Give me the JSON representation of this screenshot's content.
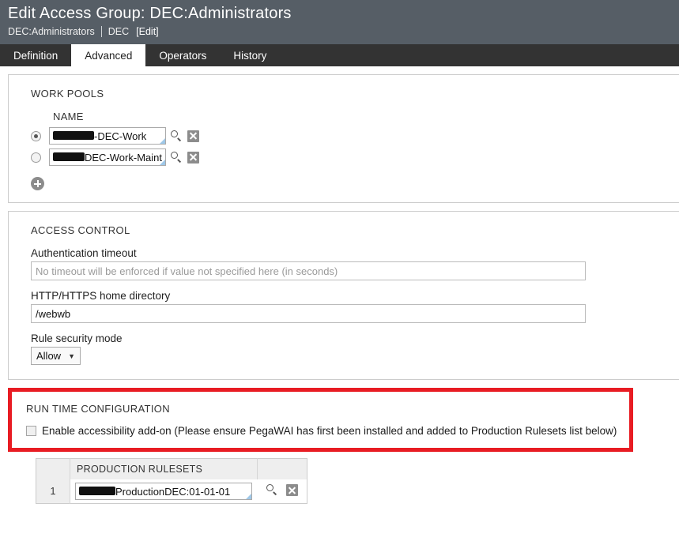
{
  "header": {
    "title": "Edit Access Group: DEC:Administrators",
    "breadcrumb": {
      "primary": "DEC:Administrators",
      "secondary": "DEC",
      "edit_link": "[Edit]"
    }
  },
  "tabs": [
    {
      "label": "Definition",
      "active": false
    },
    {
      "label": "Advanced",
      "active": true
    },
    {
      "label": "Operators",
      "active": false
    },
    {
      "label": "History",
      "active": false
    }
  ],
  "work_pools": {
    "section_title": "WORK POOLS",
    "column_header": "NAME",
    "rows": [
      {
        "selected": true,
        "value": "-DEC-Work",
        "redacted_prefix": true
      },
      {
        "selected": false,
        "value": "DEC-Work-Maint",
        "redacted_prefix": true
      }
    ],
    "add_icon": "plus-icon"
  },
  "access_control": {
    "section_title": "ACCESS CONTROL",
    "auth_timeout": {
      "label": "Authentication timeout",
      "value": "",
      "placeholder": "No timeout will be enforced if value not specified here (in seconds)"
    },
    "home_directory": {
      "label": "HTTP/HTTPS home directory",
      "value": "/webwb",
      "placeholder": ""
    },
    "rule_security_mode": {
      "label": "Rule security mode",
      "value": "Allow",
      "options": [
        "Allow"
      ]
    }
  },
  "runtime_configuration": {
    "section_title": "RUN TIME CONFIGURATION",
    "accessibility": {
      "checked": false,
      "label": "Enable accessibility add-on (Please ensure PegaWAI has first been installed and added to Production Rulesets list below)"
    },
    "highlight_color": "#e81c23"
  },
  "production_rulesets": {
    "column_header": "PRODUCTION RULESETS",
    "rows": [
      {
        "index": "1",
        "value": "ProductionDEC:01-01-01",
        "redacted_prefix": true
      }
    ]
  },
  "icons": {
    "search": "magnifier-icon",
    "delete": "delete-x-icon",
    "add": "plus-circle-icon",
    "caret": "▼"
  }
}
